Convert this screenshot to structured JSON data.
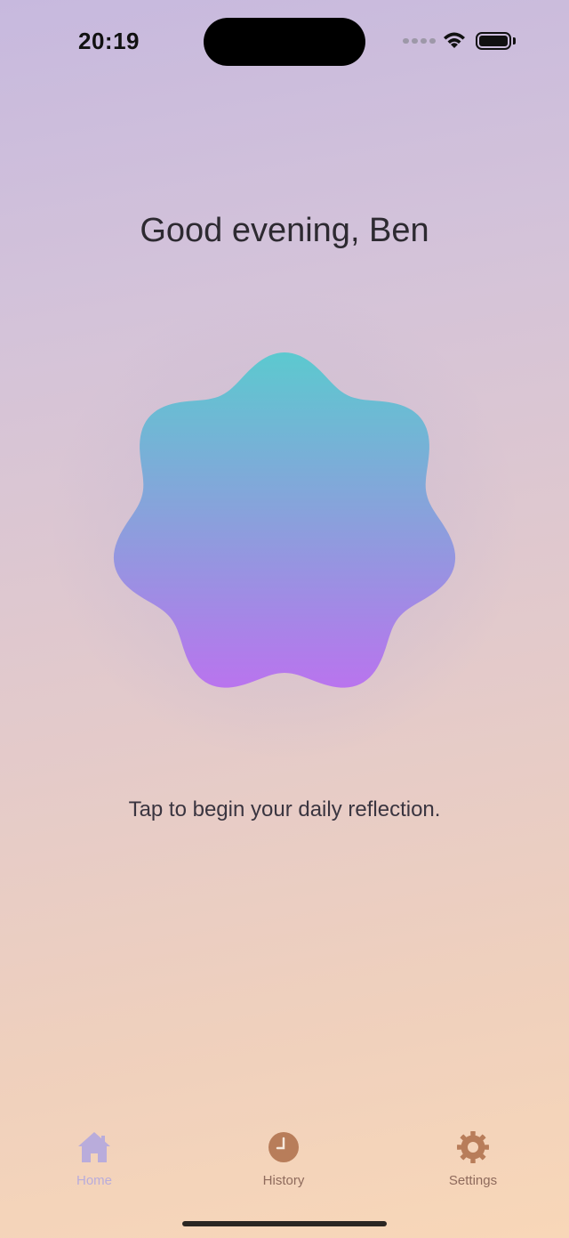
{
  "status_bar": {
    "time": "20:19",
    "icons": [
      "cellular-signal-icon",
      "wifi-icon",
      "battery-icon"
    ]
  },
  "greeting": "Good evening, Ben",
  "orb": {
    "gradient_top": "#5cc9cf",
    "gradient_bottom": "#b974ee"
  },
  "prompt": "Tap to begin your daily reflection.",
  "tab_bar": {
    "tabs": [
      {
        "label": "Home",
        "icon": "home-icon",
        "color": "#b9acdb"
      },
      {
        "label": "History",
        "icon": "clock-icon",
        "color": "#b87d5a"
      },
      {
        "label": "Settings",
        "icon": "gear-icon",
        "color": "#b87d5a"
      }
    ]
  }
}
